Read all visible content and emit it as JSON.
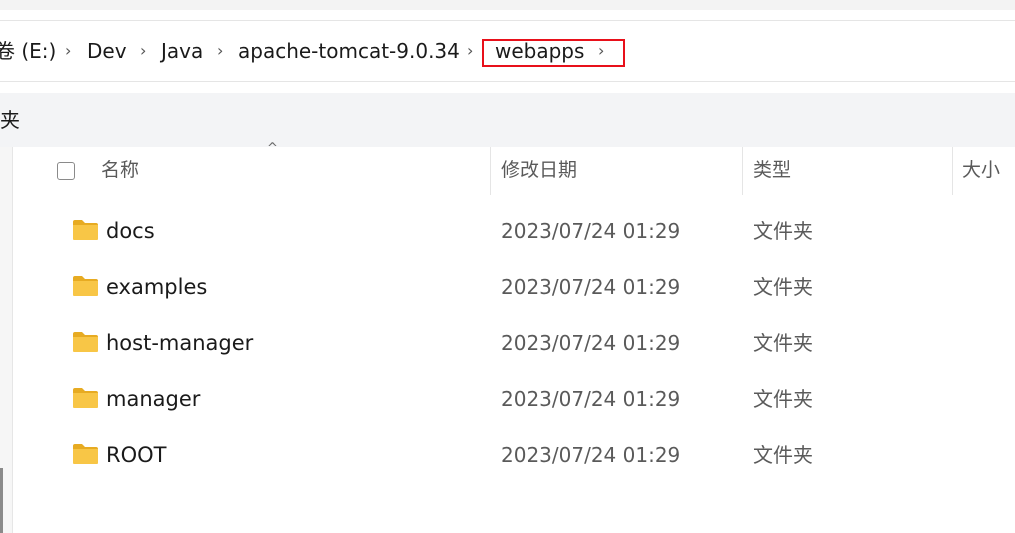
{
  "breadcrumb": {
    "items": [
      "卷 (E:)",
      "Dev",
      "Java",
      "apache-tomcat-9.0.34",
      "webapps"
    ],
    "separator": "›"
  },
  "command_bar": {
    "label": "夹"
  },
  "columns": {
    "name": "名称",
    "date": "修改日期",
    "type": "类型",
    "size": "大小"
  },
  "sort_indicator": "^",
  "files": [
    {
      "name": "docs",
      "date": "2023/07/24 01:29",
      "type": "文件夹"
    },
    {
      "name": "examples",
      "date": "2023/07/24 01:29",
      "type": "文件夹"
    },
    {
      "name": "host-manager",
      "date": "2023/07/24 01:29",
      "type": "文件夹"
    },
    {
      "name": "manager",
      "date": "2023/07/24 01:29",
      "type": "文件夹"
    },
    {
      "name": "ROOT",
      "date": "2023/07/24 01:29",
      "type": "文件夹"
    }
  ],
  "colors": {
    "highlight_border": "#e8101a",
    "folder": "#f8c646",
    "folder_tab": "#e7ab22"
  },
  "icons": {
    "folder": "folder-icon",
    "separator": "chevron-right-icon"
  }
}
